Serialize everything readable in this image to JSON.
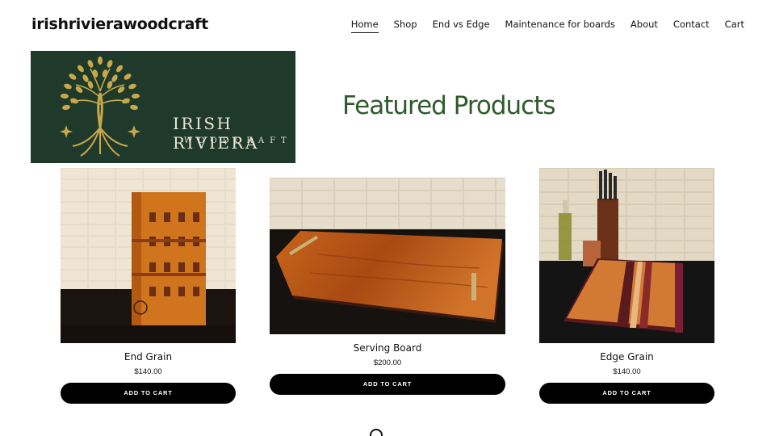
{
  "header": {
    "site_title": "irishrivierawoodcraft",
    "nav": [
      {
        "label": "Home"
      },
      {
        "label": "Shop"
      },
      {
        "label": "End vs Edge"
      },
      {
        "label": "Maintenance for boards"
      },
      {
        "label": "About"
      },
      {
        "label": "Contact"
      },
      {
        "label": "Cart"
      }
    ]
  },
  "logo": {
    "line1": "IRISH RIVIERA",
    "line2": "WOODCRAFT",
    "background_color": "#1f3a2a",
    "accent_color": "#c9a84c"
  },
  "featured": {
    "title": "Featured Products",
    "title_color": "#2f5a2c",
    "products": [
      {
        "name": "End Grain",
        "price": "$140.00",
        "button": "ADD TO CART"
      },
      {
        "name": "Serving Board",
        "price": "$200.00",
        "button": "ADD TO CART"
      },
      {
        "name": "Edge Grain",
        "price": "$140.00",
        "button": "ADD TO CART"
      }
    ]
  }
}
